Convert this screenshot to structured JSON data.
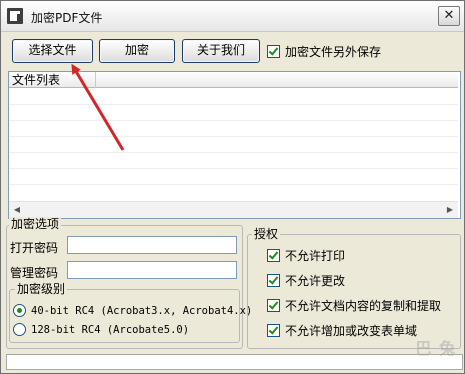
{
  "window": {
    "title": "加密PDF文件",
    "close_label": "✕"
  },
  "toolbar": {
    "select_file": "选择文件",
    "encrypt": "加密",
    "about": "关于我们",
    "save_separately": {
      "label": "加密文件另外保存",
      "checked": true
    }
  },
  "file_list": {
    "header": "文件列表",
    "items": []
  },
  "encrypt_options": {
    "legend": "加密选项",
    "open_password": {
      "label": "打开密码",
      "value": ""
    },
    "admin_password": {
      "label": "管理密码",
      "value": ""
    },
    "level": {
      "legend": "加密级别",
      "options": [
        {
          "label": "40-bit RC4 (Acrobat3.x, Acrobat4.x)",
          "selected": true
        },
        {
          "label": "128-bit RC4 (Arcobate5.0)",
          "selected": false
        }
      ]
    }
  },
  "permissions": {
    "legend": "授权",
    "items": [
      {
        "label": "不允许打印",
        "checked": true
      },
      {
        "label": "不允许更改",
        "checked": true
      },
      {
        "label": "不允许文档内容的复制和提取",
        "checked": true
      },
      {
        "label": "不允许增加或改变表单域",
        "checked": true
      }
    ]
  },
  "watermark": "巴 兔",
  "colors": {
    "annotation_arrow": "#d0282a",
    "check_mark": "#1f8a1f"
  }
}
